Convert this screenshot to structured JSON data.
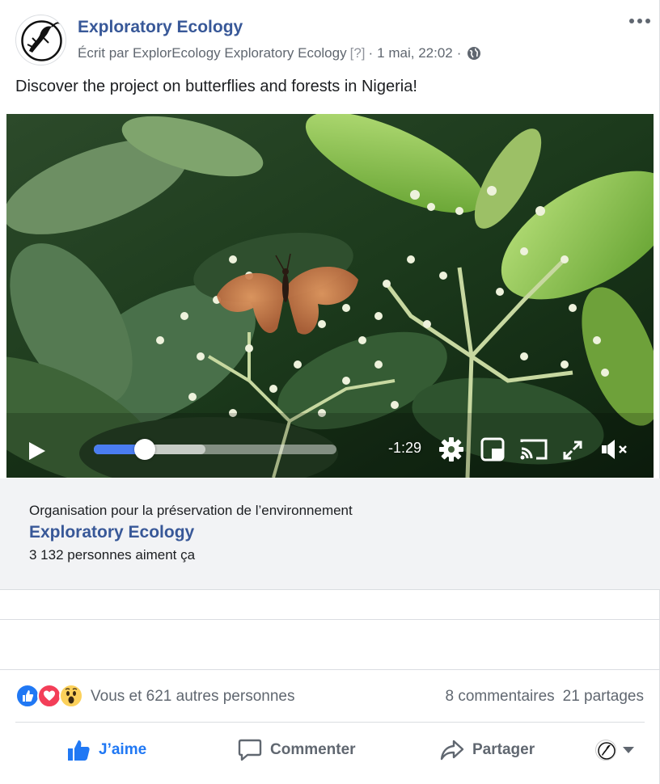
{
  "post": {
    "page_name": "Exploratory Ecology",
    "meta": {
      "written_by": "Écrit par ExplorEcology Exploratory Ecology",
      "help_marker": "[?]",
      "separator": "·",
      "timestamp": "1 mai, 22:02",
      "privacy_icon": "globe-icon"
    },
    "more_icon": "more-options-icon",
    "text": "Discover the project on butterflies and forests in Nigeria!"
  },
  "video": {
    "remaining_time": "-1:29",
    "progress": 0.21,
    "buffered": 0.46,
    "controls": [
      "play-icon",
      "settings-gear-icon",
      "picture-in-picture-icon",
      "cast-icon",
      "fullscreen-icon",
      "volume-muted-icon"
    ]
  },
  "page_info": {
    "category": "Organisation pour la préservation de l’environnement",
    "name": "Exploratory Ecology",
    "likes": "3 132 personnes aiment ça"
  },
  "reactions": {
    "icons": [
      "like-reaction-icon",
      "love-reaction-icon",
      "wow-reaction-icon"
    ],
    "summary": "Vous et 621 autres personnes",
    "comments": "8 commentaires",
    "shares": "21 partages"
  },
  "actions": {
    "like": "J’aime",
    "comment": "Commenter",
    "share": "Partager"
  },
  "colors": {
    "link": "#385898",
    "like_blue": "#2078f4",
    "love_red": "#f33e58",
    "wow_yellow": "#fcd15b",
    "muted_text": "#606770",
    "progress_blue": "#4a7df1"
  }
}
